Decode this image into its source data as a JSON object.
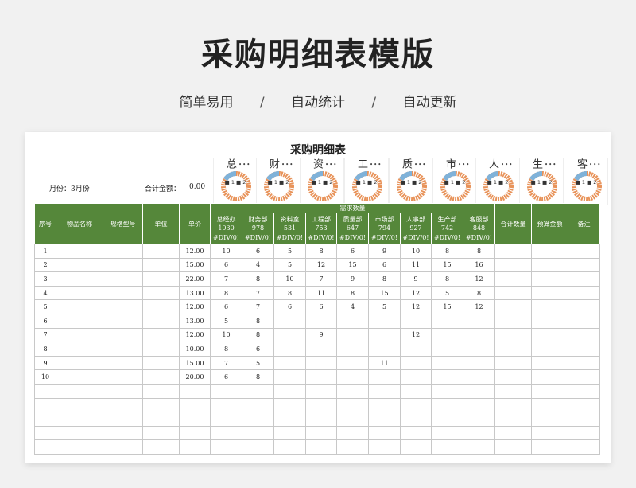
{
  "page": {
    "title": "采购明细表模版",
    "features": [
      "简单易用",
      "自动统计",
      "自动更新"
    ],
    "separator": "/"
  },
  "sheet": {
    "title": "采购明细表",
    "month_label": "月份：3月份",
    "total_label": "合计金额：",
    "total_value": "0.00"
  },
  "donuts": [
    {
      "name": "总",
      "dots": "•••",
      "legend": "■ 1 ■ 2"
    },
    {
      "name": "财",
      "dots": "•••",
      "legend": "■ 1 ■ 2"
    },
    {
      "name": "资",
      "dots": "•••",
      "legend": "■ 1 ■ 2"
    },
    {
      "name": "工",
      "dots": "•••",
      "legend": "■ 1 ■ 2"
    },
    {
      "name": "质",
      "dots": "•••",
      "legend": "■ 1 ■ 2"
    },
    {
      "name": "市",
      "dots": "•••",
      "legend": "■ 1 ■ 2"
    },
    {
      "name": "人",
      "dots": "•••",
      "legend": "■ 1 ■ 2"
    },
    {
      "name": "生",
      "dots": "•••",
      "legend": "■ 1 ■ 2"
    },
    {
      "name": "客",
      "dots": "•••",
      "legend": "■ 1 ■ 2"
    }
  ],
  "colors": {
    "header_green": "#55873a",
    "donut_orange": "#e8935a",
    "donut_blue": "#7fb2d9"
  },
  "headers": {
    "seq": "序号",
    "item_name": "物品名称",
    "spec": "规格型号",
    "unit": "单位",
    "price": "单价",
    "demand": "需求数量",
    "total_qty": "合计数量",
    "budget": "预算金额",
    "remark": "备注"
  },
  "departments": [
    {
      "name": "总经办",
      "total": "1030",
      "pct": "#DIV/0!"
    },
    {
      "name": "财务部",
      "total": "978",
      "pct": "#DIV/0!"
    },
    {
      "name": "资料室",
      "total": "531",
      "pct": "#DIV/0!"
    },
    {
      "name": "工程部",
      "total": "753",
      "pct": "#DIV/0!"
    },
    {
      "name": "质量部",
      "total": "647",
      "pct": "#DIV/0!"
    },
    {
      "name": "市场部",
      "total": "794",
      "pct": "#DIV/0!"
    },
    {
      "name": "人事部",
      "total": "927",
      "pct": "#DIV/0!"
    },
    {
      "name": "生产部",
      "total": "742",
      "pct": "#DIV/0!"
    },
    {
      "name": "客服部",
      "total": "848",
      "pct": "#DIV/0!"
    }
  ],
  "rows": [
    {
      "seq": "1",
      "price": "12.00",
      "q": [
        "10",
        "6",
        "5",
        "8",
        "6",
        "9",
        "10",
        "8",
        "8"
      ]
    },
    {
      "seq": "2",
      "price": "15.00",
      "q": [
        "6",
        "4",
        "5",
        "12",
        "15",
        "6",
        "11",
        "15",
        "16"
      ]
    },
    {
      "seq": "3",
      "price": "22.00",
      "q": [
        "7",
        "8",
        "10",
        "7",
        "9",
        "8",
        "9",
        "8",
        "12"
      ]
    },
    {
      "seq": "4",
      "price": "13.00",
      "q": [
        "8",
        "7",
        "8",
        "11",
        "8",
        "15",
        "12",
        "5",
        "8"
      ]
    },
    {
      "seq": "5",
      "price": "12.00",
      "q": [
        "6",
        "7",
        "6",
        "6",
        "4",
        "5",
        "12",
        "15",
        "12"
      ]
    },
    {
      "seq": "6",
      "price": "13.00",
      "q": [
        "5",
        "8",
        "",
        "",
        "",
        "",
        "",
        "",
        ""
      ]
    },
    {
      "seq": "7",
      "price": "12.00",
      "q": [
        "10",
        "8",
        "",
        "9",
        "",
        "",
        "12",
        "",
        ""
      ]
    },
    {
      "seq": "8",
      "price": "10.00",
      "q": [
        "8",
        "6",
        "",
        "",
        "",
        "",
        "",
        "",
        ""
      ]
    },
    {
      "seq": "9",
      "price": "15.00",
      "q": [
        "7",
        "5",
        "",
        "",
        "",
        "11",
        "",
        "",
        ""
      ]
    },
    {
      "seq": "10",
      "price": "20.00",
      "q": [
        "6",
        "8",
        "",
        "",
        "",
        "",
        "",
        "",
        ""
      ]
    },
    {
      "seq": "",
      "price": "",
      "q": [
        "",
        "",
        "",
        "",
        "",
        "",
        "",
        "",
        ""
      ]
    },
    {
      "seq": "",
      "price": "",
      "q": [
        "",
        "",
        "",
        "",
        "",
        "",
        "",
        "",
        ""
      ]
    },
    {
      "seq": "",
      "price": "",
      "q": [
        "",
        "",
        "",
        "",
        "",
        "",
        "",
        "",
        ""
      ]
    },
    {
      "seq": "",
      "price": "",
      "q": [
        "",
        "",
        "",
        "",
        "",
        "",
        "",
        "",
        ""
      ]
    },
    {
      "seq": "",
      "price": "",
      "q": [
        "",
        "",
        "",
        "",
        "",
        "",
        "",
        "",
        ""
      ]
    }
  ]
}
